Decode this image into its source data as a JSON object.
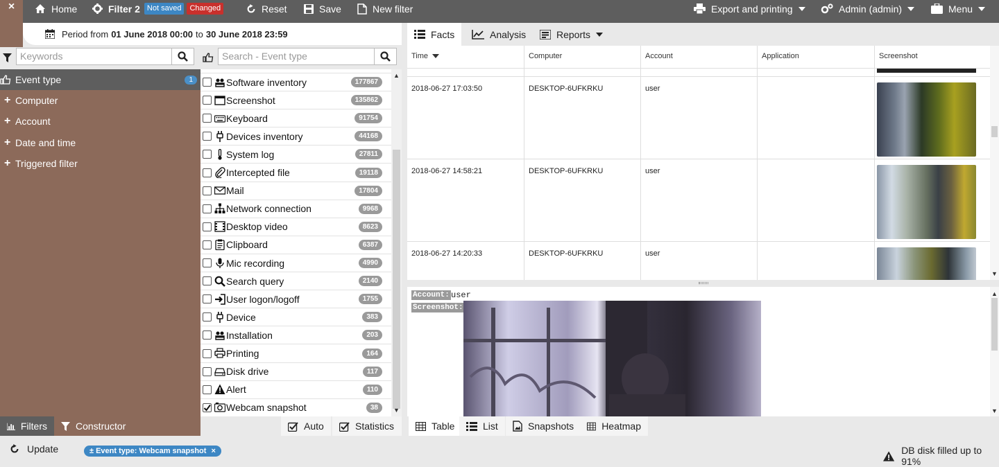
{
  "topbar": {
    "close": "×",
    "home": "Home",
    "filter_name": "Filter 2",
    "badge_not_saved": "Not saved",
    "badge_changed": "Changed",
    "reset": "Reset",
    "save": "Save",
    "new_filter": "New filter",
    "export": "Export and printing",
    "admin": "Admin (admin)",
    "menu": "Menu"
  },
  "period": {
    "prefix": "Period from",
    "from": "01 June 2018 00:00",
    "to_word": "to",
    "to": "30 June 2018 23:59"
  },
  "search": {
    "keywords_placeholder": "Keywords",
    "event_type_placeholder": "Search - Event type"
  },
  "sidebar": {
    "items": [
      {
        "label": "Event type",
        "count": "1",
        "active": true
      },
      {
        "label": "Computer"
      },
      {
        "label": "Account"
      },
      {
        "label": "Date and time"
      },
      {
        "label": "Triggered filter"
      }
    ]
  },
  "event_types": [
    {
      "label": "Software inventory",
      "count": "177867",
      "icon": "user-group-icon",
      "checked": false
    },
    {
      "label": "Screenshot",
      "count": "135862",
      "icon": "window-icon",
      "checked": false
    },
    {
      "label": "Keyboard",
      "count": "91754",
      "icon": "keyboard-icon",
      "checked": false
    },
    {
      "label": "Devices inventory",
      "count": "44168",
      "icon": "plug-icon",
      "checked": false
    },
    {
      "label": "System log",
      "count": "27811",
      "icon": "thermometer-icon",
      "checked": false
    },
    {
      "label": "Intercepted file",
      "count": "19118",
      "icon": "paperclip-icon",
      "checked": false
    },
    {
      "label": "Mail",
      "count": "17804",
      "icon": "envelope-icon",
      "checked": false
    },
    {
      "label": "Network connection",
      "count": "9968",
      "icon": "network-icon",
      "checked": false
    },
    {
      "label": "Desktop video",
      "count": "8623",
      "icon": "film-icon",
      "checked": false
    },
    {
      "label": "Clipboard",
      "count": "6387",
      "icon": "clipboard-icon",
      "checked": false
    },
    {
      "label": "Mic recording",
      "count": "4990",
      "icon": "microphone-icon",
      "checked": false
    },
    {
      "label": "Search query",
      "count": "2140",
      "icon": "search-icon",
      "checked": false
    },
    {
      "label": "User logon/logoff",
      "count": "1755",
      "icon": "sign-in-icon",
      "checked": false
    },
    {
      "label": "Device",
      "count": "383",
      "icon": "plug-icon",
      "checked": false
    },
    {
      "label": "Installation",
      "count": "203",
      "icon": "user-group-icon",
      "checked": false
    },
    {
      "label": "Printing",
      "count": "164",
      "icon": "printer-icon",
      "checked": false
    },
    {
      "label": "Disk drive",
      "count": "117",
      "icon": "hdd-icon",
      "checked": false
    },
    {
      "label": "Alert",
      "count": "110",
      "icon": "warning-icon",
      "checked": false
    },
    {
      "label": "Webcam snapshot",
      "count": "38",
      "icon": "camera-icon",
      "checked": true
    }
  ],
  "tabs": {
    "facts": "Facts",
    "analysis": "Analysis",
    "reports": "Reports"
  },
  "table": {
    "columns": [
      "Time",
      "Computer",
      "Account",
      "Application",
      "Screenshot"
    ],
    "rows": [
      {
        "time": "2018-06-27 17:03:50",
        "computer": "DESKTOP-6UFKRKU",
        "account": "user",
        "application": ""
      },
      {
        "time": "2018-06-27 14:58:21",
        "computer": "DESKTOP-6UFKRKU",
        "account": "user",
        "application": ""
      },
      {
        "time": "2018-06-27 14:20:33",
        "computer": "DESKTOP-6UFKRKU",
        "account": "user",
        "application": ""
      }
    ]
  },
  "detail": {
    "account_label": "Account:",
    "account_value": "user",
    "screenshot_label": "Screenshot:"
  },
  "bottom": {
    "filters": "Filters",
    "constructor": "Constructor",
    "auto": "Auto",
    "statistics": "Statistics",
    "table": "Table",
    "list": "List",
    "snapshots": "Snapshots",
    "heatmap": "Heatmap"
  },
  "status": {
    "update": "Update",
    "chip": "± Event type: Webcam snapshot",
    "chip_close": "×",
    "disk": "DB disk filled up to 91%"
  },
  "colors": {
    "topbar": "#5e5e5e",
    "sidebar": "#8c6a5a",
    "badge_not_saved": "#3d87c4",
    "badge_changed": "#c9302c",
    "chip": "#3d87c4"
  }
}
